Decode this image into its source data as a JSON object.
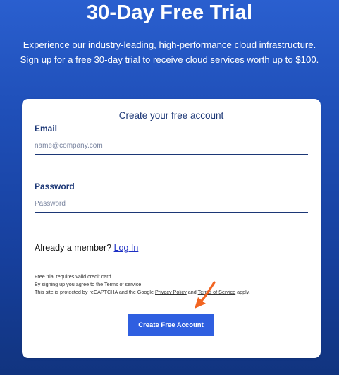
{
  "hero": {
    "title": "30-Day Free Trial",
    "subtitle_line1": "Experience our industry-leading, high-performance cloud infrastructure.",
    "subtitle_line2": "Sign up for a free 30-day trial to receive cloud services worth up to $100."
  },
  "form": {
    "title": "Create your free account",
    "email_label": "Email",
    "email_placeholder": "name@company.com",
    "password_label": "Password",
    "password_placeholder": "Password",
    "member_text": "Already a member?",
    "login_link": "Log In",
    "fine_print": {
      "line1": "Free trial requires valid credit card",
      "line2_prefix": "By signing up you agree to the",
      "terms_link": "Terms of service",
      "line3_prefix": "This site is protected by reCAPTCHA and the Google",
      "privacy_link": "Privacy Policy",
      "and": "and",
      "tos_link": "Terms of Service",
      "line3_suffix": "apply."
    },
    "submit_label": "Create Free Account"
  },
  "annotation": {
    "arrow_color": "#f26522",
    "arrow_icon": "pointer-arrow-icon"
  }
}
